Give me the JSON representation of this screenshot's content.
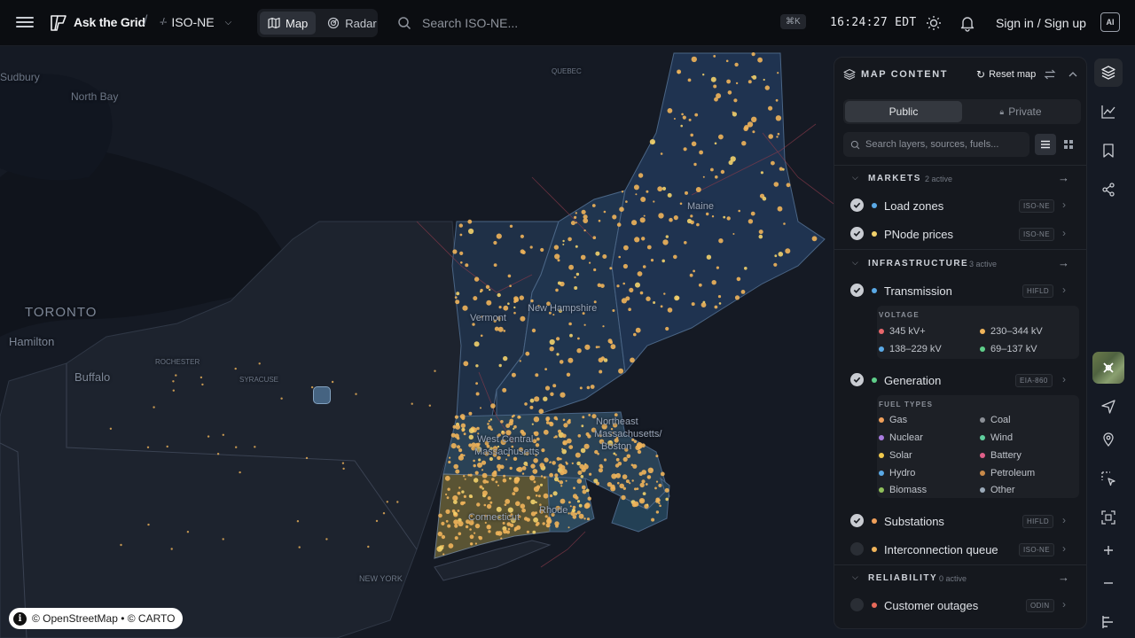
{
  "topbar": {
    "brand": "Ask the Grid",
    "separator": "/",
    "region_prefix": "-/-",
    "region": "ISO-NE",
    "modes": [
      {
        "label": "Map",
        "active": true
      },
      {
        "label": "Radar",
        "active": false
      }
    ],
    "search_placeholder": "Search ISO-NE...",
    "shortcut": "⌘K",
    "clock": "16:24:27 EDT",
    "signin": "Sign in / Sign up",
    "ai_label": "AI"
  },
  "map": {
    "labels": {
      "toronto": "TORONTO",
      "hamilton": "Hamilton",
      "buffalo": "Buffalo",
      "vermont": "Vermont",
      "new_hampshire": "New Hampshire",
      "maine": "Maine",
      "west_central_ma": "West Central",
      "massachusetts": "Massachusetts",
      "northeast_ma": "Northeast",
      "massachusetts_2": "Massachusetts/",
      "boston": "Boston",
      "connecticut": "Connecticut",
      "rhode_island": "Rhode",
      "new_york": "NEW YORK",
      "north_bay": "North Bay",
      "sudbury": "Sudbury",
      "quebec": "QUEBEC",
      "syracuse": "SYRACUSE",
      "rochester": "ROCHESTER"
    },
    "attribution": "© OpenStreetMap • © CARTO"
  },
  "panel": {
    "title": "MAP CONTENT",
    "reset_label": "Reset map",
    "tabs": [
      {
        "label": "Public",
        "active": true
      },
      {
        "label": "Private",
        "active": false
      }
    ],
    "search_placeholder": "Search layers, sources, fuels...",
    "sections": {
      "markets": {
        "title": "MARKETS",
        "count": "2 active"
      },
      "infrastructure": {
        "title": "INFRASTRUCTURE",
        "count": "3 active"
      },
      "reliability": {
        "title": "RELIABILITY",
        "count": "0 active"
      }
    },
    "layers": {
      "load_zones": {
        "label": "Load zones",
        "source": "ISO-NE",
        "checked": true,
        "color": "#5aa9e6"
      },
      "pnode_prices": {
        "label": "PNode prices",
        "source": "ISO-NE",
        "checked": true,
        "color": "#f2d16b"
      },
      "transmission": {
        "label": "Transmission",
        "source": "HIFLD",
        "checked": true,
        "color": "#5aa9e6"
      },
      "generation": {
        "label": "Generation",
        "source": "EIA-860",
        "checked": true,
        "color": "#5fcf8a"
      },
      "substations": {
        "label": "Substations",
        "source": "HIFLD",
        "checked": true,
        "color": "#f0a05a"
      },
      "interconnection": {
        "label": "Interconnection queue",
        "source": "ISO-NE",
        "checked": false,
        "color": "#f0b45a"
      },
      "outages": {
        "label": "Customer outages",
        "source": "ODIN",
        "checked": false,
        "color": "#e86a5a"
      }
    },
    "voltage": {
      "title": "VOLTAGE",
      "items": [
        {
          "label": "345 kV+",
          "color": "#e8676b"
        },
        {
          "label": "230–344 kV",
          "color": "#f0b45a"
        },
        {
          "label": "138–229 kV",
          "color": "#5aa9e6"
        },
        {
          "label": "69–137 kV",
          "color": "#5fcf8a"
        }
      ]
    },
    "fuel": {
      "title": "FUEL TYPES",
      "items": [
        {
          "label": "Gas",
          "color": "#f0a05a"
        },
        {
          "label": "Coal",
          "color": "#8b8f96"
        },
        {
          "label": "Nuclear",
          "color": "#a97be0"
        },
        {
          "label": "Wind",
          "color": "#5fcf9e"
        },
        {
          "label": "Solar",
          "color": "#f2c94c"
        },
        {
          "label": "Battery",
          "color": "#e0608a"
        },
        {
          "label": "Hydro",
          "color": "#5aa9e6"
        },
        {
          "label": "Petroleum",
          "color": "#c98a4a"
        },
        {
          "label": "Biomass",
          "color": "#8fbf5a"
        },
        {
          "label": "Other",
          "color": "#9aa9b8"
        }
      ]
    }
  }
}
